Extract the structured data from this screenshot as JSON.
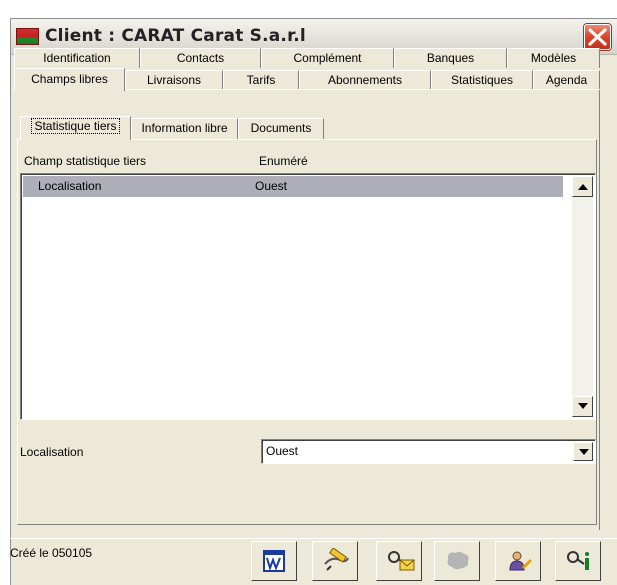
{
  "window": {
    "title": "Client : CARAT Carat S.a.r.l"
  },
  "tabs_back": [
    {
      "label": "Identification"
    },
    {
      "label": "Contacts"
    },
    {
      "label": "Complément"
    },
    {
      "label": "Banques"
    },
    {
      "label": "Modèles"
    }
  ],
  "tabs_front": [
    {
      "label": "Champs libres",
      "active": true
    },
    {
      "label": "Livraisons"
    },
    {
      "label": "Tarifs"
    },
    {
      "label": "Abonnements"
    },
    {
      "label": "Statistiques"
    },
    {
      "label": "Agenda"
    }
  ],
  "subtabs": [
    {
      "label": "Statistique tiers",
      "active": true
    },
    {
      "label": "Information libre"
    },
    {
      "label": "Documents"
    }
  ],
  "list": {
    "columns": [
      "Champ statistique tiers",
      "Enuméré"
    ],
    "rows": [
      {
        "field": "Localisation",
        "value": "Ouest",
        "selected": true
      }
    ]
  },
  "editor": {
    "label": "Localisation",
    "value": "Ouest"
  },
  "status": {
    "text": "Créé le 050105"
  },
  "toolbar": [
    {
      "icon": "word-icon"
    },
    {
      "icon": "edit-pencil-icon"
    },
    {
      "icon": "keys-envelope-icon"
    },
    {
      "icon": "delete-icon",
      "disabled": true
    },
    {
      "icon": "user-pencil-icon"
    },
    {
      "icon": "keys-info-icon"
    }
  ],
  "colors": {
    "selection": "#aeaeb8",
    "face": "#ece9d8",
    "close": "#d8442a"
  }
}
